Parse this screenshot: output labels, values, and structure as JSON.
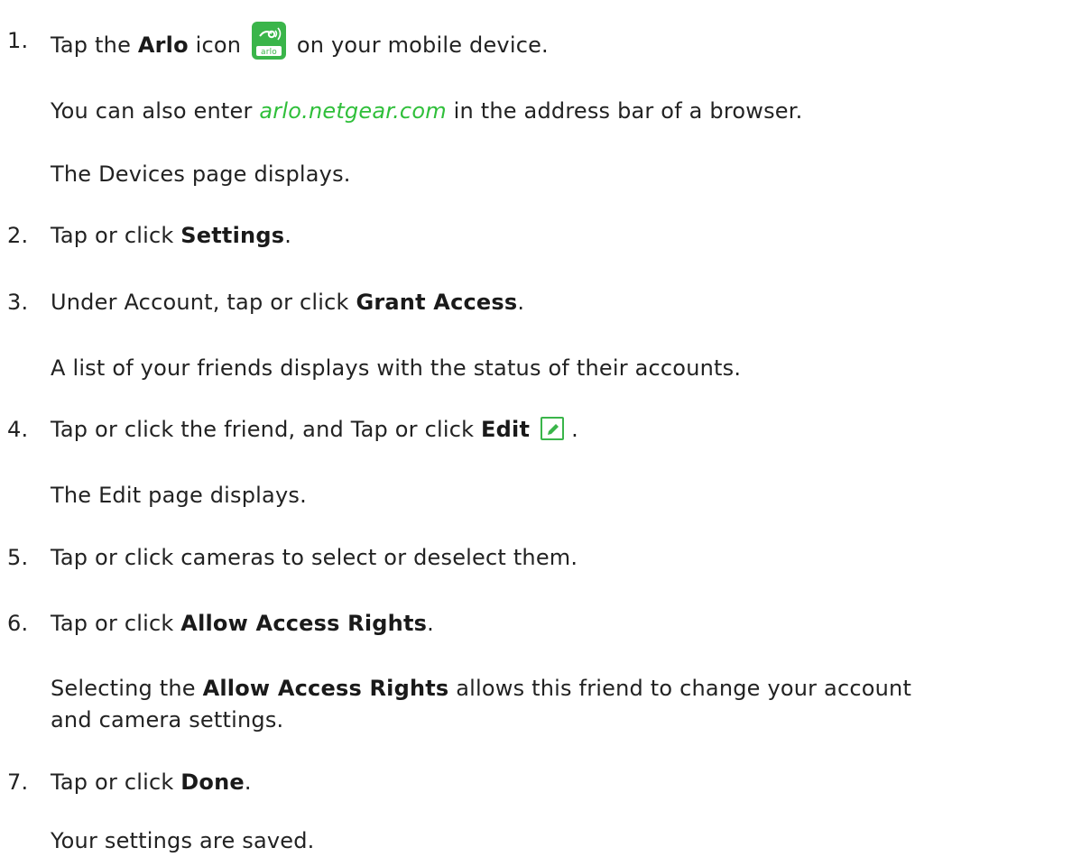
{
  "steps": [
    {
      "num": "1.",
      "pre": "Tap the ",
      "bold": "Arlo",
      "mid": " icon",
      "icon": "arlo-app-icon",
      "post": " on your mobile device.",
      "paras": [
        {
          "pre": "You can also enter ",
          "link": "arlo.netgear.com",
          "post": " in the address bar of a browser."
        },
        {
          "text": "The Devices page displays."
        }
      ]
    },
    {
      "num": "2.",
      "pre": "Tap or click ",
      "bold": "Settings",
      "post": "."
    },
    {
      "num": "3.",
      "pre": "Under Account, tap or click ",
      "bold": "Grant Access",
      "post": ".",
      "paras": [
        {
          "text": "A list of your friends displays with the status of their accounts."
        }
      ]
    },
    {
      "num": "4.",
      "pre": "Tap or click the friend, and Tap or click ",
      "bold": "Edit",
      "icon": "edit-pencil-icon",
      "post": ".",
      "paras": [
        {
          "text": "The Edit page displays."
        }
      ]
    },
    {
      "num": "5.",
      "text": "Tap or click cameras to select or deselect them."
    },
    {
      "num": "6.",
      "pre": "Tap or click ",
      "bold": "Allow Access Rights",
      "post": ".",
      "paras": [
        {
          "pre": "Selecting the ",
          "bold": "Allow Access Rights",
          "post_line1": " allows this friend to change your account",
          "line2": "and camera settings."
        }
      ]
    },
    {
      "num": "7.",
      "pre": "Tap or click ",
      "bold": "Done",
      "post": ".",
      "paras": [
        {
          "text": "Your settings are saved."
        }
      ]
    }
  ],
  "colors": {
    "text": "#222222",
    "link": "#2fbf3a",
    "icon_green": "#3ab54a"
  }
}
